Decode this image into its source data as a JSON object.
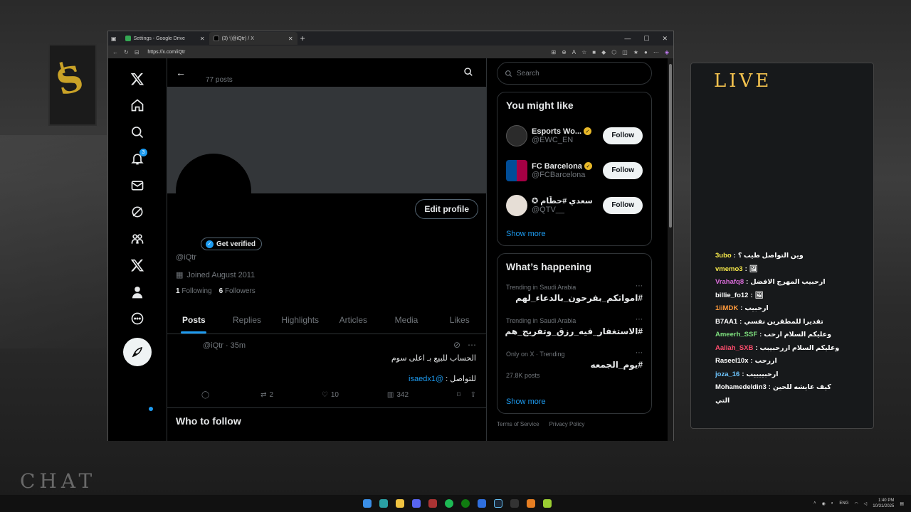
{
  "browser": {
    "tabs": [
      {
        "label": "Settings - Google Drive",
        "active": false
      },
      {
        "label": "(3) ⁱ(@iQtr) / X",
        "active": true
      }
    ],
    "url": "https://x.com/iQtr"
  },
  "nav": {
    "notifications_badge": "3"
  },
  "profile": {
    "post_count": "77 posts",
    "edit_label": "Edit profile",
    "verify_label": "Get verified",
    "handle": "@iQtr",
    "joined": "Joined August 2011",
    "following_count": "1",
    "following_label": "Following",
    "followers_count": "6",
    "followers_label": "Followers"
  },
  "tabs": [
    "Posts",
    "Replies",
    "Highlights",
    "Articles",
    "Media",
    "Likes"
  ],
  "tweet": {
    "meta": "@iQtr · 35m",
    "line1": "الحساب للبيع بـ اعلى سوم",
    "line2_prefix": "للتواصل : ",
    "line2_mention": "@isaedx1",
    "replies": "",
    "reposts": "2",
    "likes": "10",
    "views": "342"
  },
  "who_to_follow_title": "Who to follow",
  "sidebar": {
    "search_placeholder": "Search",
    "might_like_title": "You might like",
    "suggestions": [
      {
        "name": "Esports Wo...",
        "handle": "@EWC_EN",
        "avatar_color": "#2b2b2b",
        "follow": "Follow"
      },
      {
        "name": "FC Barcelona",
        "handle": "@FCBarcelona",
        "avatar_color": "#a50044",
        "follow": "Follow"
      },
      {
        "name": "✪ سعدي #حطّام",
        "handle": "@QTV__",
        "avatar_color": "#e6ded6",
        "follow": "Follow"
      }
    ],
    "show_more": "Show more",
    "happening_title": "What’s happening",
    "trends": [
      {
        "context": "Trending in Saudi Arabia",
        "name": "#امواتكم_بفرحون_بالدعاء_لهم",
        "count": ""
      },
      {
        "context": "Trending in Saudi Arabia",
        "name": "#الاستغفار_فيه_رزق_وتفريج_هم",
        "count": ""
      },
      {
        "context": "Only on X · Trending",
        "name": "#يوم_الجمعه",
        "count": "27.8K posts"
      }
    ],
    "show_more2": "Show more",
    "footer": [
      "Terms of Service",
      "Privacy Policy"
    ]
  },
  "chat": {
    "title": "LIVE",
    "messages": [
      {
        "user": "3ubo",
        "text": "وين التواصل طيب ؟",
        "color": "#f7e94a"
      },
      {
        "user": "vmemo3",
        "text": "🖼",
        "color": "#f7e94a"
      },
      {
        "user": "Vrahafq8",
        "text": "ارحبيب المهرج الافضل",
        "color": "#d86bd8"
      },
      {
        "user": "billie_fo12",
        "text": "🖼",
        "color": "#ffffff"
      },
      {
        "user": "1iiMDK",
        "text": "ارحبيب",
        "color": "#ff9a3c"
      },
      {
        "user": "B7AA1",
        "text": "تقديرا للمطقرين نفسي",
        "color": "#ffffff"
      },
      {
        "user": "Ameerh_SSF",
        "text": "وعليكم السلام ارحب",
        "color": "#7ee07e"
      },
      {
        "user": "Aaliah_SXB",
        "text": "وعليكم السلام اررحبيبب",
        "color": "#ff4d6d"
      },
      {
        "user": "Raseel10x",
        "text": "اررحب",
        "color": "#ffffff"
      },
      {
        "user": "joza_16",
        "text": "ارحبييييب",
        "color": "#6ec6ff"
      },
      {
        "user": "Mohamedeldin3",
        "text": "كيف عايشه للحين",
        "color": "#ffffff"
      }
    ],
    "overflow_line": "التي"
  },
  "background": {
    "chat_logo": "CHAT"
  },
  "taskbar": {
    "lang": "ENG",
    "time": "1:40 PM",
    "date": "10/31/2025"
  }
}
